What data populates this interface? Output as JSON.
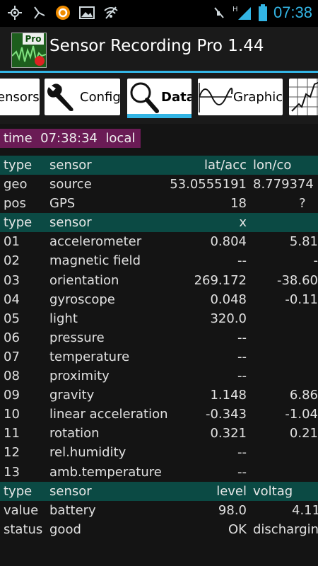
{
  "statusbar": {
    "left_icons": [
      "gps-icon",
      "call-missed-icon",
      "avast-icon",
      "image-icon",
      "wifi-off-icon"
    ],
    "right_icons": [
      "mute-icon",
      "signal-icon",
      "battery-icon"
    ],
    "network": "H",
    "time": "07:38"
  },
  "title": {
    "text": "Sensor Recording Pro 1.44",
    "icon_label": "Pro"
  },
  "tabs": [
    {
      "label": "ensors",
      "icon": null
    },
    {
      "label": "Config",
      "icon": "wrench-icon"
    },
    {
      "label": "Data",
      "icon": "magnifier-icon",
      "active": true
    },
    {
      "label": "Graphic",
      "icon": "sine-wave-icon"
    },
    {
      "label": "",
      "icon": "map-icon"
    }
  ],
  "time_bar": {
    "label": "time",
    "value": "07:38:34",
    "zone": "local"
  },
  "table": {
    "header1": [
      "type",
      "sensor",
      "lat/acc",
      "lon/co"
    ],
    "rows1": [
      [
        "geo",
        "source",
        "53.0555191",
        "8.779374"
      ],
      [
        "pos",
        "GPS",
        "18",
        "?"
      ]
    ],
    "header2": [
      "type",
      "sensor",
      "x",
      ""
    ],
    "rows2": [
      [
        "01",
        "accelerometer",
        "0.804",
        "5.81"
      ],
      [
        "02",
        "magnetic field",
        "--",
        "-"
      ],
      [
        "03",
        "orientation",
        "269.172",
        "-38.60"
      ],
      [
        "04",
        "gyroscope",
        "0.048",
        "-0.11"
      ],
      [
        "05",
        "light",
        "320.0",
        ""
      ],
      [
        "06",
        "pressure",
        "--",
        ""
      ],
      [
        "07",
        "temperature",
        "--",
        ""
      ],
      [
        "08",
        "proximity",
        "--",
        ""
      ],
      [
        "09",
        "gravity",
        "1.148",
        "6.86"
      ],
      [
        "10",
        "linear acceleration",
        "-0.343",
        "-1.04"
      ],
      [
        "11",
        "rotation",
        "0.321",
        "0.21"
      ],
      [
        "12",
        "rel.humidity",
        "--",
        ""
      ],
      [
        "13",
        "amb.temperature",
        "--",
        ""
      ]
    ],
    "header3": [
      "type",
      "sensor",
      "level",
      "voltag"
    ],
    "rows3": [
      [
        "value",
        "battery",
        "98.0",
        "4.11"
      ],
      [
        "status",
        "good",
        "OK",
        "discharging"
      ]
    ]
  },
  "colors": {
    "accent": "#33b5e5",
    "header_bg": "#0b4a44",
    "time_bg": "#6a1b55",
    "background": "#141414"
  }
}
